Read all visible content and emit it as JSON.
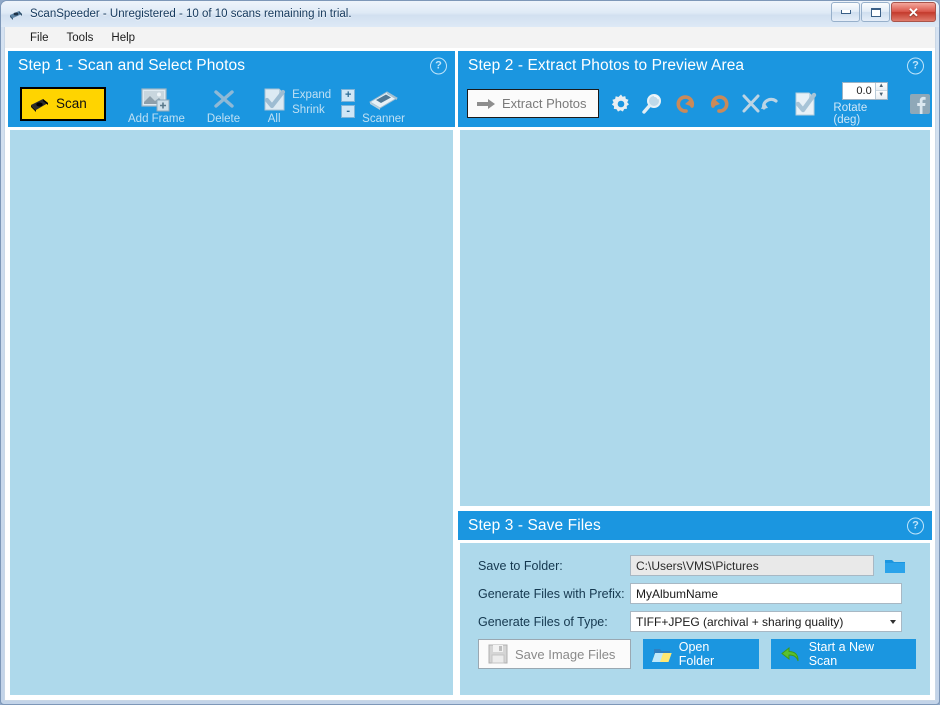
{
  "window": {
    "title": "ScanSpeeder - Unregistered - 10 of 10 scans remaining in trial.",
    "app_icon": "scanner-icon",
    "minimize_label": "Minimize",
    "maximize_label": "Maximize",
    "close_label": "Close"
  },
  "menubar": {
    "items": [
      {
        "label": "File"
      },
      {
        "label": "Tools"
      },
      {
        "label": "Help"
      }
    ]
  },
  "step1": {
    "title": "Step 1 - Scan and Select Photos",
    "help": "?",
    "toolbar": {
      "scan": {
        "label": "Scan",
        "icon": "scanner-icon"
      },
      "add_frame": {
        "label": "Add Frame",
        "icon": "add-frame-icon"
      },
      "delete": {
        "label": "Delete",
        "icon": "delete-x-icon"
      },
      "all": {
        "label": "All",
        "icon": "select-all-check-icon"
      },
      "expand": {
        "label": "Expand"
      },
      "shrink": {
        "label": "Shrink"
      },
      "plus": {
        "label": "+"
      },
      "minus": {
        "label": "-"
      },
      "scanner": {
        "label": "Scanner",
        "icon": "flatbed-scanner-icon"
      }
    }
  },
  "step2": {
    "title": "Step 2 - Extract Photos to Preview Area",
    "help": "?",
    "toolbar": {
      "extract": {
        "label": "Extract Photos",
        "icon": "right-arrow-icon"
      },
      "settings": {
        "icon": "gear-icon"
      },
      "zoom": {
        "icon": "magnifier-icon"
      },
      "rotate_left": {
        "icon": "rotate-left-icon"
      },
      "rotate_right": {
        "icon": "rotate-right-icon"
      },
      "crop": {
        "icon": "scissors-x-icon"
      },
      "undo": {
        "icon": "undo-arrow-icon"
      },
      "approve": {
        "icon": "check-document-icon"
      },
      "rotate_value": "0.0",
      "rotate_label": "Rotate (deg)",
      "facebook": {
        "icon": "facebook-icon"
      }
    }
  },
  "step3": {
    "title": "Step 3 - Save Files",
    "help": "?",
    "fields": [
      {
        "label": "Save to Folder:",
        "value": "C:\\Users\\VMS\\Pictures"
      },
      {
        "label": "Generate Files with Prefix:",
        "value": "MyAlbumName"
      },
      {
        "label": "Generate Files of Type:",
        "value": "TIFF+JPEG (archival + sharing quality)"
      }
    ],
    "folder_button": {
      "icon": "folder-icon"
    },
    "buttons": {
      "save": {
        "label": "Save Image Files",
        "icon": "floppy-disk-icon"
      },
      "open_folder": {
        "label": "Open Folder",
        "icon": "open-folder-icon"
      },
      "new_scan": {
        "label": "Start a New Scan",
        "icon": "green-back-arrow-icon"
      }
    }
  },
  "colors": {
    "accent_blue": "#1b96e0",
    "panel_blue": "#aed9eb",
    "scan_yellow": "#ffd400"
  }
}
